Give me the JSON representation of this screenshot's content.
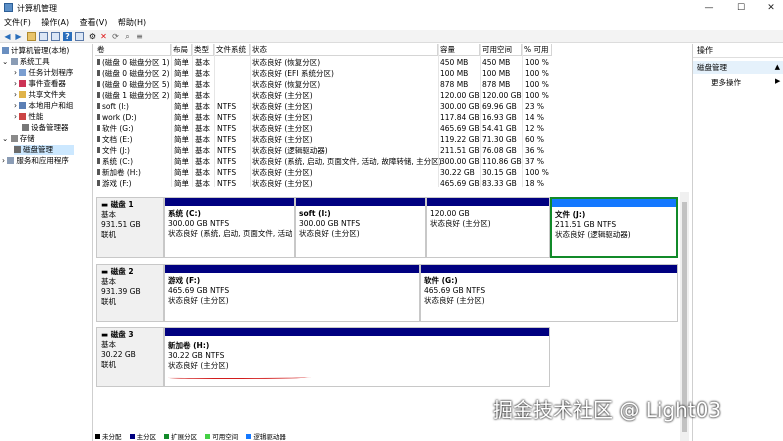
{
  "window": {
    "title": "计算机管理",
    "min_icon": "minimize-icon",
    "max_icon": "maximize-icon",
    "close_icon": "close-icon"
  },
  "menu": [
    "文件(F)",
    "操作(A)",
    "查看(V)",
    "帮助(H)"
  ],
  "toolbar_icons": [
    "back-icon",
    "forward-icon",
    "up-icon",
    "show-hide-tree-icon",
    "help-icon",
    "properties-icon",
    "delete-icon",
    "refresh-icon",
    "export-icon",
    "search-icon",
    "settings-icon"
  ],
  "tree": {
    "root": "计算机管理(本地)",
    "system_tools": "系统工具",
    "task_scheduler": "任务计划程序",
    "event_viewer": "事件查看器",
    "shared_folders": "共享文件夹",
    "local_users": "本地用户和组",
    "performance": "性能",
    "device_manager": "设备管理器",
    "storage": "存储",
    "disk_management": "磁盘管理",
    "services": "服务和应用程序"
  },
  "columns": {
    "volume": "卷",
    "layout": "布局",
    "type": "类型",
    "fs": "文件系统",
    "status": "状态",
    "capacity": "容量",
    "free": "可用空间",
    "pct": "% 可用"
  },
  "volumes": [
    {
      "name": "(磁盘 0 磁盘分区 1)",
      "layout": "简单",
      "type": "基本",
      "fs": "",
      "status": "状态良好 (恢复分区)",
      "capacity": "450 MB",
      "free": "450 MB",
      "pct": "100 %"
    },
    {
      "name": "(磁盘 0 磁盘分区 2)",
      "layout": "简单",
      "type": "基本",
      "fs": "",
      "status": "状态良好 (EFI 系统分区)",
      "capacity": "100 MB",
      "free": "100 MB",
      "pct": "100 %"
    },
    {
      "name": "(磁盘 0 磁盘分区 5)",
      "layout": "简单",
      "type": "基本",
      "fs": "",
      "status": "状态良好 (恢复分区)",
      "capacity": "878 MB",
      "free": "878 MB",
      "pct": "100 %"
    },
    {
      "name": "(磁盘 1 磁盘分区 2)",
      "layout": "简单",
      "type": "基本",
      "fs": "",
      "status": "状态良好 (主分区)",
      "capacity": "120.00 GB",
      "free": "120.00 GB",
      "pct": "100 %"
    },
    {
      "name": "soft (I:)",
      "layout": "简单",
      "type": "基本",
      "fs": "NTFS",
      "status": "状态良好 (主分区)",
      "capacity": "300.00 GB",
      "free": "69.96 GB",
      "pct": "23 %"
    },
    {
      "name": "work (D:)",
      "layout": "简单",
      "type": "基本",
      "fs": "NTFS",
      "status": "状态良好 (主分区)",
      "capacity": "117.84 GB",
      "free": "16.93 GB",
      "pct": "14 %"
    },
    {
      "name": "软件 (G:)",
      "layout": "简单",
      "type": "基本",
      "fs": "NTFS",
      "status": "状态良好 (主分区)",
      "capacity": "465.69 GB",
      "free": "54.41 GB",
      "pct": "12 %"
    },
    {
      "name": "文档 (E:)",
      "layout": "简单",
      "type": "基本",
      "fs": "NTFS",
      "status": "状态良好 (主分区)",
      "capacity": "119.22 GB",
      "free": "71.30 GB",
      "pct": "60 %"
    },
    {
      "name": "文件 (J:)",
      "layout": "简单",
      "type": "基本",
      "fs": "NTFS",
      "status": "状态良好 (逻辑驱动器)",
      "capacity": "211.51 GB",
      "free": "76.08 GB",
      "pct": "36 %"
    },
    {
      "name": "系统 (C:)",
      "layout": "简单",
      "type": "基本",
      "fs": "NTFS",
      "status": "状态良好 (系统, 启动, 页面文件, 活动, 故障转储, 主分区)",
      "capacity": "300.00 GB",
      "free": "110.86 GB",
      "pct": "37 %"
    },
    {
      "name": "新加卷 (H:)",
      "layout": "简单",
      "type": "基本",
      "fs": "NTFS",
      "status": "状态良好 (主分区)",
      "capacity": "30.22 GB",
      "free": "30.15 GB",
      "pct": "100 %"
    },
    {
      "name": "游戏 (F:)",
      "layout": "简单",
      "type": "基本",
      "fs": "NTFS",
      "status": "状态良好 (主分区)",
      "capacity": "465.69 GB",
      "free": "83.33 GB",
      "pct": "18 %"
    }
  ],
  "disks": [
    {
      "name": "磁盘 1",
      "type": "基本",
      "size": "931.51 GB",
      "state": "联机",
      "partitions": [
        {
          "name": "系统 (C:)",
          "size": "300.00 GB NTFS",
          "status": "状态良好 (系统, 启动, 页面文件, 活动",
          "selected": false
        },
        {
          "name": "soft (I:)",
          "size": "300.00 GB NTFS",
          "status": "状态良好 (主分区)",
          "selected": false
        },
        {
          "name": "",
          "size": "120.00 GB",
          "status": "状态良好 (主分区)",
          "selected": false
        },
        {
          "name": "文件 (J:)",
          "size": "211.51 GB NTFS",
          "status": "状态良好 (逻辑驱动器)",
          "selected": true
        }
      ]
    },
    {
      "name": "磁盘 2",
      "type": "基本",
      "size": "931.39 GB",
      "state": "联机",
      "partitions": [
        {
          "name": "游戏 (F:)",
          "size": "465.69 GB NTFS",
          "status": "状态良好 (主分区)",
          "selected": false
        },
        {
          "name": "软件 (G:)",
          "size": "465.69 GB NTFS",
          "status": "状态良好 (主分区)",
          "selected": false
        }
      ]
    },
    {
      "name": "磁盘 3",
      "type": "基本",
      "size": "30.22 GB",
      "state": "联机",
      "partitions": [
        {
          "name": "新加卷 (H:)",
          "size": "30.22 GB NTFS",
          "status": "状态良好 (主分区)",
          "selected": false
        }
      ]
    }
  ],
  "legend": [
    {
      "label": "未分配",
      "color": "#000000"
    },
    {
      "label": "主分区",
      "color": "#000080"
    },
    {
      "label": "扩展分区",
      "color": "#118a29"
    },
    {
      "label": "可用空间",
      "color": "#44d044"
    },
    {
      "label": "逻辑驱动器",
      "color": "#1478ff"
    }
  ],
  "actions": {
    "header": "操作",
    "section": "磁盘管理",
    "more": "更多操作"
  },
  "watermark": "掘金技术社区 @ Light03",
  "colors": {
    "primary_stripe": "#000080",
    "logical_stripe": "#1478ff",
    "selection_border": "#118a29",
    "annotation": "#d21d1d"
  }
}
